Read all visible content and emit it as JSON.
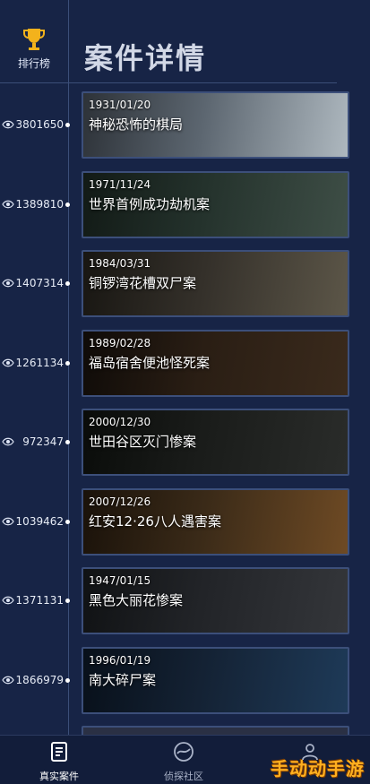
{
  "header": {
    "title": "案件详情"
  },
  "sidebar": {
    "ranking_label": "排行榜"
  },
  "cases": [
    {
      "date": "1931/01/20",
      "title": "神秘恐怖的棋局",
      "views": "3801650",
      "colors": [
        "#aeb8bf",
        "#5c6670",
        "#2d3238"
      ]
    },
    {
      "date": "1971/11/24",
      "title": "世界首例成功劫机案",
      "views": "1389810",
      "colors": [
        "#3e4e46",
        "#24322c",
        "#121a16"
      ]
    },
    {
      "date": "1984/03/31",
      "title": "铜锣湾花槽双尸案",
      "views": "1407314",
      "colors": [
        "#5c5648",
        "#34302a",
        "#181612"
      ]
    },
    {
      "date": "1989/02/28",
      "title": "福岛宿舍便池怪死案",
      "views": "1261134",
      "colors": [
        "#3a2a1c",
        "#2a1e14",
        "#0f0b08"
      ]
    },
    {
      "date": "2000/12/30",
      "title": "世田谷区灭门惨案",
      "views": "972347",
      "colors": [
        "#2a2c2a",
        "#1a1c1a",
        "#0a0c0a"
      ]
    },
    {
      "date": "2007/12/26",
      "title": "红安12·26八人遇害案",
      "views": "1039462",
      "colors": [
        "#6e4a24",
        "#3a2a18",
        "#1a120a"
      ]
    },
    {
      "date": "1947/01/15",
      "title": "黑色大丽花惨案",
      "views": "1371131",
      "colors": [
        "#34363a",
        "#222428",
        "#101214"
      ]
    },
    {
      "date": "1996/01/19",
      "title": "南大碎尸案",
      "views": "1866979",
      "colors": [
        "#1e3a58",
        "#142234",
        "#08101a"
      ]
    }
  ],
  "bottom_nav": [
    {
      "label": "真实案件",
      "icon": "document-icon",
      "active": true
    },
    {
      "label": "侦探社区",
      "icon": "community-icon",
      "active": false
    }
  ],
  "watermark": "手动动手游",
  "colors": {
    "background": "#172446",
    "card_border": "#3c4f7a",
    "watermark": "#ffb020"
  }
}
